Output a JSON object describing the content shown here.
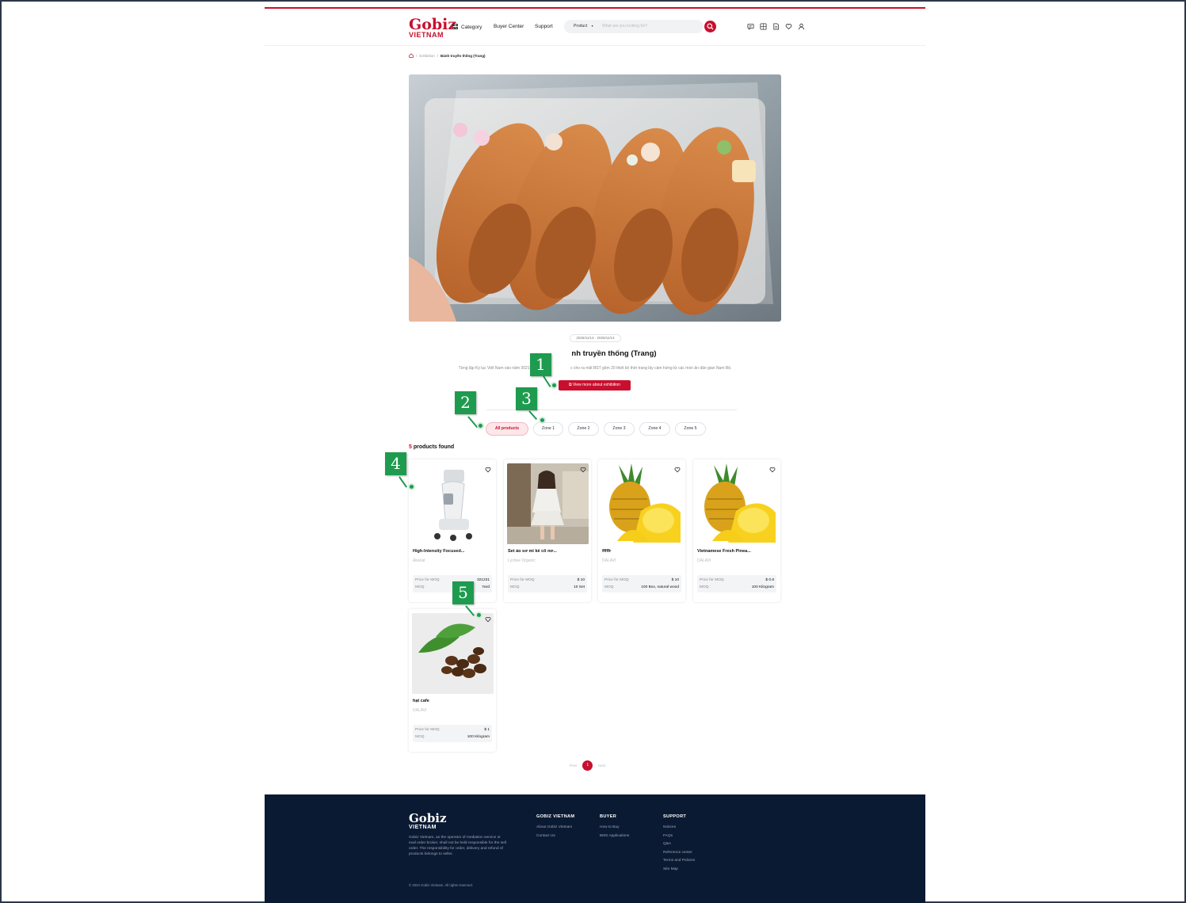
{
  "header": {
    "logo_top": "Gobiz",
    "logo_bottom": "VIETNAM",
    "nav": {
      "category": "Category",
      "buyer_center": "Buyer Center",
      "support": "Support"
    },
    "search": {
      "selector": "Product",
      "placeholder": "What are you looking for?"
    }
  },
  "breadcrumb": {
    "parent": "Exhibition",
    "sep": "/",
    "current": "Bánh truyền thống (Trang)"
  },
  "exhibition": {
    "dates": "2025/11/13 - 2025/11/14",
    "title_visible": "nh truyền thống (Trang)",
    "description_left": "Từng lập Kỷ lục Việt Nam vào năm 2021, NTK V",
    "description_right": "c cho ra mắt BST gồm 20 thiết kế thời trang lấy cảm hứng từ các món ăn dân gian Nam Bộ.",
    "view_more_label": "View more about exhibition"
  },
  "tabs": [
    "All products",
    "Zone 1",
    "Zone 2",
    "Zone 3",
    "Zone 4",
    "Zone 5"
  ],
  "results": {
    "count": "5",
    "label": "products found"
  },
  "products": [
    {
      "name": "High-Intensity Focused...",
      "seller": "Akanat",
      "price_label": "Price for MOQ",
      "price": "321231",
      "moq_label": "MOQ",
      "moq": "Yard"
    },
    {
      "name": "Set áo sơ mi kẻ cổ nơ...",
      "seller": "Lychee Organic",
      "price_label": "Price for MOQ",
      "price": "$ 10",
      "moq_label": "MOQ",
      "moq": "10 Set"
    },
    {
      "name": "fffffr",
      "seller": "DALAVI",
      "price_label": "Price for MOQ",
      "price": "$ 10",
      "moq_label": "MOQ",
      "moq": "100 Box, natural wood"
    },
    {
      "name": "Vietnamese Fresh Pinea...",
      "seller": "DALAVI",
      "price_label": "Price for MOQ",
      "price": "$ 0.8",
      "moq_label": "MOQ",
      "moq": "100 Kilogram"
    },
    {
      "name": "hạt cafe",
      "seller": "DALAVI",
      "price_label": "Price for MOQ",
      "price": "$ 1",
      "moq_label": "MOQ",
      "moq": "100 Kilogram"
    }
  ],
  "pagination": {
    "prev": "Prev",
    "current": "1",
    "next": "Next"
  },
  "footer": {
    "logo_top": "Gobiz",
    "logo_bottom": "VIETNAM",
    "description": "Gobiz Vietnam, as the operator of mediation service or mail order broker, shall not be held responsible for the sell order. The responsibility for order, delivery and refund of products belongs to seller.",
    "copyright": "© 2024 Gobiz Vietnam. All rights reserved.",
    "columns": [
      {
        "heading": "GOBIZ VIETNAM",
        "items": [
          "About Gobiz Vietnam",
          "Contact Us"
        ]
      },
      {
        "heading": "BUYER",
        "items": [
          "How to Buy",
          "BMS Applications"
        ]
      },
      {
        "heading": "SUPPORT",
        "items": [
          "Notices",
          "FAQs",
          "Q&A",
          "Reference center",
          "Terms and Policies",
          "Site Map"
        ]
      }
    ]
  },
  "markers": [
    "1",
    "2",
    "3",
    "4",
    "5"
  ],
  "colors": {
    "brand_red": "#c8102e",
    "footer_bg": "#0b1a33",
    "marker_green": "#1e9b4f"
  }
}
